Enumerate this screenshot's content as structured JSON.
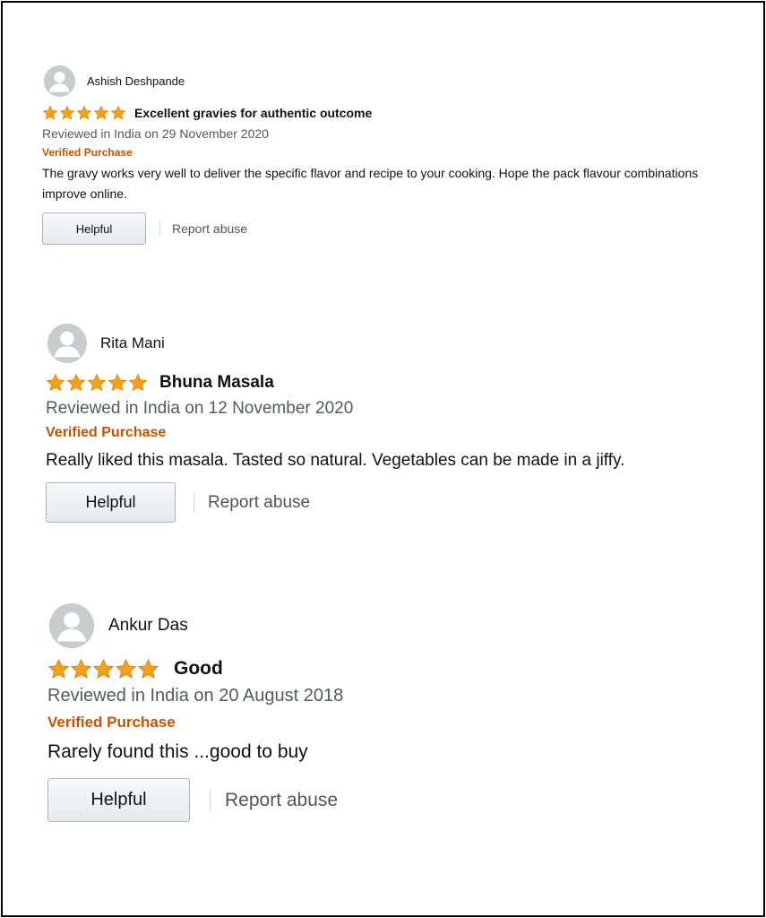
{
  "colors": {
    "star": "#f4a11a",
    "verified": "#c45500",
    "date": "#565959",
    "avatar_bg": "#c8cccc",
    "avatar_fg": "#ffffff"
  },
  "reviews": [
    {
      "author": "Ashish Deshpande",
      "avatar_icon": "user-avatar-icon",
      "rating": 5,
      "title": "Excellent gravies for authentic outcome",
      "date": "Reviewed in India on 29 November 2020",
      "verified": "Verified Purchase",
      "body": "The gravy works very well to deliver the specific flavor and recipe to your cooking. Hope the pack flavour combinations improve online.",
      "helpful_label": "Helpful",
      "report_label": "Report abuse"
    },
    {
      "author": "Rita Mani",
      "avatar_icon": "user-avatar-icon",
      "rating": 5,
      "title": "Bhuna Masala",
      "date": "Reviewed in India on 12 November 2020",
      "verified": "Verified Purchase",
      "body": "Really liked this masala. Tasted so natural. Vegetables can be made in a jiffy.",
      "helpful_label": "Helpful",
      "report_label": "Report abuse"
    },
    {
      "author": "Ankur Das",
      "avatar_icon": "user-avatar-icon",
      "rating": 5,
      "title": "Good",
      "date": "Reviewed in India on 20 August 2018",
      "verified": "Verified Purchase",
      "body": "Rarely found this ...good to buy",
      "helpful_label": "Helpful",
      "report_label": "Report abuse"
    }
  ]
}
